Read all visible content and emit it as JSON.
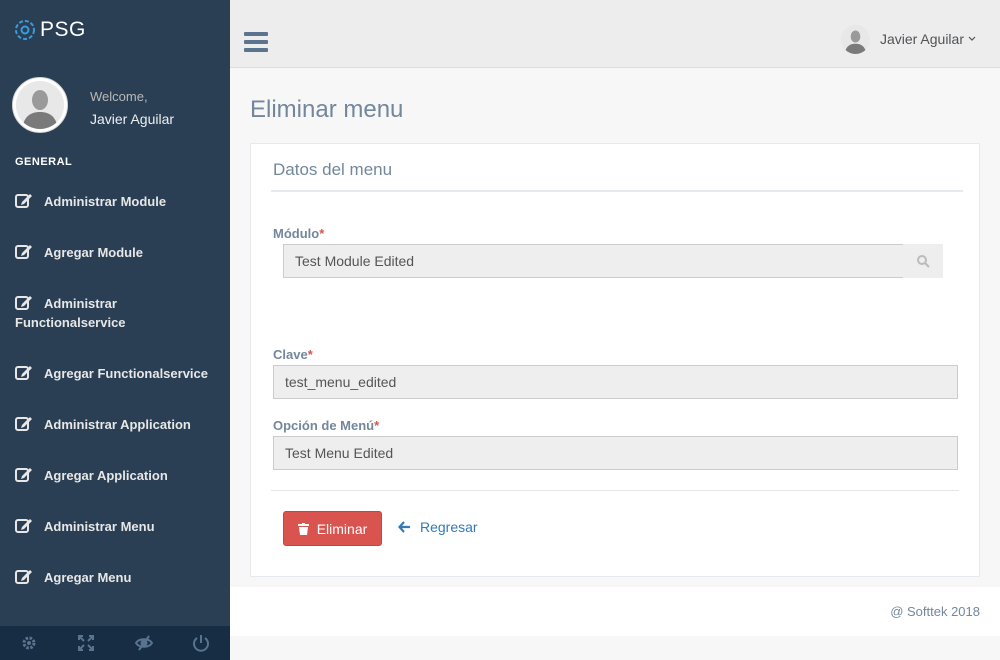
{
  "brand": {
    "name": "PSG"
  },
  "profile": {
    "welcome": "Welcome,",
    "name": "Javier Aguilar"
  },
  "sidebar": {
    "section_title": "GENERAL",
    "items": [
      {
        "label": "Administrar Module",
        "icon": "edit-icon"
      },
      {
        "label": "Agregar Module",
        "icon": "edit-icon"
      },
      {
        "label": "Administrar Functionalservice",
        "icon": "edit-icon"
      },
      {
        "label": "Agregar Functionalservice",
        "icon": "edit-icon"
      },
      {
        "label": "Administrar Application",
        "icon": "edit-icon"
      },
      {
        "label": "Agregar Application",
        "icon": "edit-icon"
      },
      {
        "label": "Administrar Menu",
        "icon": "edit-icon"
      },
      {
        "label": "Agregar Menu",
        "icon": "edit-icon"
      }
    ],
    "footer_icons": [
      "settings-icon",
      "fullscreen-icon",
      "lock-icon",
      "logout-icon"
    ]
  },
  "topnav": {
    "user_name": "Javier Aguilar"
  },
  "page": {
    "title": "Eliminar menu"
  },
  "panel": {
    "title": "Datos del menu",
    "modulo": {
      "label": "Módulo",
      "required": "*",
      "value": "Test Module Edited"
    },
    "clave": {
      "label": "Clave",
      "required": "*",
      "value": "test_menu_edited"
    },
    "opcion": {
      "label": "Opción de Menú",
      "required": "*",
      "value": "Test Menu Edited"
    },
    "delete_label": "Eliminar",
    "back_label": "Regresar"
  },
  "footer": {
    "text": "@ Softtek 2018"
  },
  "colors": {
    "sidebar": "#2A3F54",
    "danger": "#d9534f",
    "link": "#337ab7",
    "brand_accent": "#1ABB9C"
  }
}
